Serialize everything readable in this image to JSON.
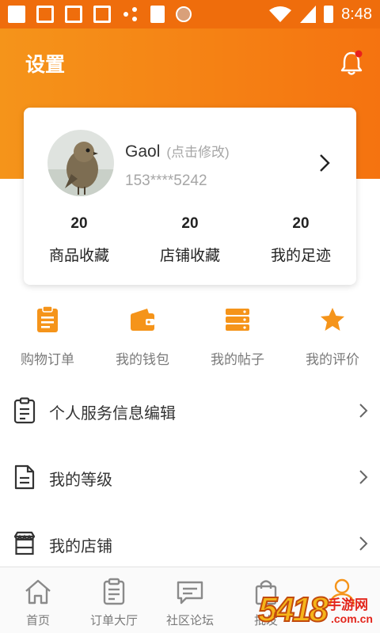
{
  "status_bar": {
    "time": "8:48"
  },
  "header": {
    "title": "设置"
  },
  "profile": {
    "name": "Gaol",
    "edit_hint": "(点击修改)",
    "phone": "153****5242"
  },
  "stats": [
    {
      "value": "20",
      "label": "商品收藏"
    },
    {
      "value": "20",
      "label": "店铺收藏"
    },
    {
      "value": "20",
      "label": "我的足迹"
    }
  ],
  "quick_actions": [
    {
      "label": "购物订单",
      "icon": "clipboard-icon"
    },
    {
      "label": "我的钱包",
      "icon": "wallet-icon"
    },
    {
      "label": "我的帖子",
      "icon": "stack-icon"
    },
    {
      "label": "我的评价",
      "icon": "star-icon"
    }
  ],
  "menu": [
    {
      "label": "个人服务信息编辑",
      "icon": "clipboard-outline-icon"
    },
    {
      "label": "我的等级",
      "icon": "document-icon"
    },
    {
      "label": "我的店铺",
      "icon": "store-icon"
    }
  ],
  "tabs": [
    {
      "label": "首页",
      "icon": "home-icon"
    },
    {
      "label": "订单大厅",
      "icon": "order-list-icon"
    },
    {
      "label": "社区论坛",
      "icon": "chat-icon"
    },
    {
      "label": "批发",
      "icon": "bag-icon"
    },
    {
      "label": "",
      "icon": "person-icon"
    }
  ],
  "watermark": {
    "number": "5418",
    "text1": "手游网",
    "text2": ".com.cn"
  },
  "colors": {
    "accent": "#f5941a",
    "accent_dark": "#f57310",
    "text": "#333333",
    "muted": "#7a7a7a"
  }
}
